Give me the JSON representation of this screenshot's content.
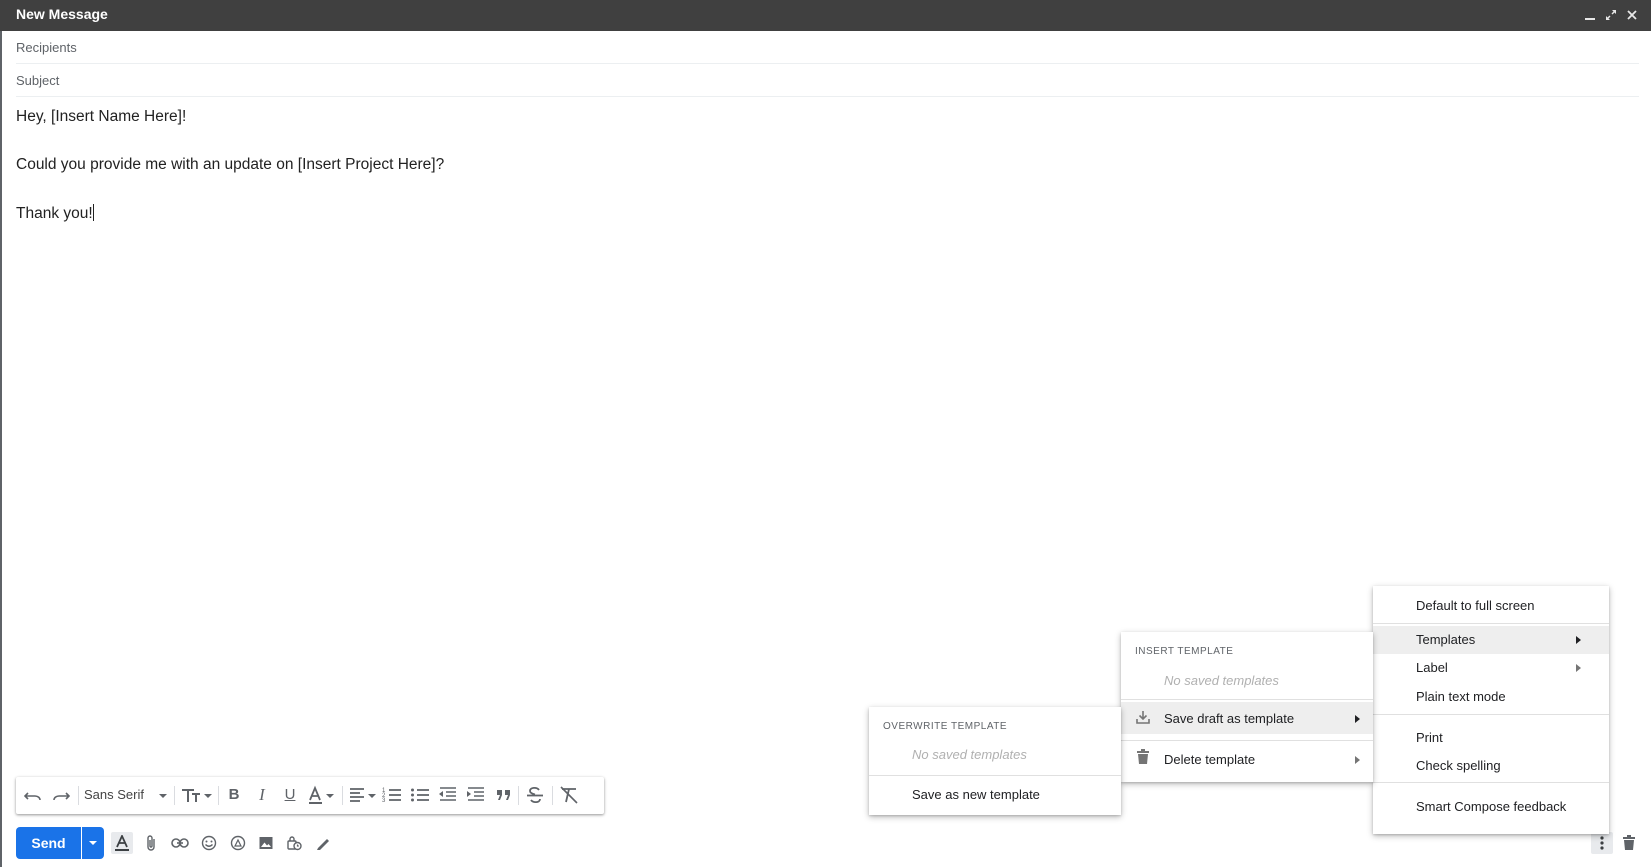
{
  "window": {
    "title": "New Message",
    "controls": [
      "minimize-icon",
      "expand-icon",
      "close-icon"
    ]
  },
  "compose": {
    "recipients_placeholder": "Recipients",
    "subject_placeholder": "Subject",
    "body": {
      "line1": "Hey, [Insert Name Here]!",
      "line2": "Could you provide me with an update on [Insert Project Here]?",
      "line3": "Thank you!"
    }
  },
  "formatting": {
    "font": "Sans Serif",
    "icons": [
      "undo-icon",
      "redo-icon",
      "font-size-icon",
      "bold-icon",
      "italic-icon",
      "underline-icon",
      "text-color-icon",
      "align-icon",
      "numbered-list-icon",
      "bulleted-list-icon",
      "indent-less-icon",
      "indent-more-icon",
      "quote-icon",
      "strikethrough-icon",
      "remove-formatting-icon"
    ]
  },
  "bottombar": {
    "send_label": "Send",
    "icons": [
      "formatting-options-icon",
      "attach-icon",
      "link-icon",
      "emoji-icon",
      "drive-icon",
      "photo-icon",
      "confidential-icon",
      "signature-icon",
      "more-options-icon",
      "discard-icon"
    ]
  },
  "more_menu": {
    "items": [
      {
        "label": "Default to full screen"
      },
      {
        "label": "Templates",
        "submenu": true,
        "highlighted": true
      },
      {
        "label": "Label",
        "submenu": true
      },
      {
        "label": "Plain text mode"
      },
      {
        "label": "Print"
      },
      {
        "label": "Check spelling"
      },
      {
        "label": "Smart Compose feedback"
      }
    ]
  },
  "templates_menu": {
    "section_header": "INSERT TEMPLATE",
    "empty_text": "No saved templates",
    "save_label": "Save draft as template",
    "delete_label": "Delete template"
  },
  "save_menu": {
    "section_header": "OVERWRITE TEMPLATE",
    "empty_text": "No saved templates",
    "new_label": "Save as new template"
  },
  "colors": {
    "titlebar": "#404040",
    "send_button": "#1a73e8",
    "menu_highlight": "#eeeeee"
  }
}
